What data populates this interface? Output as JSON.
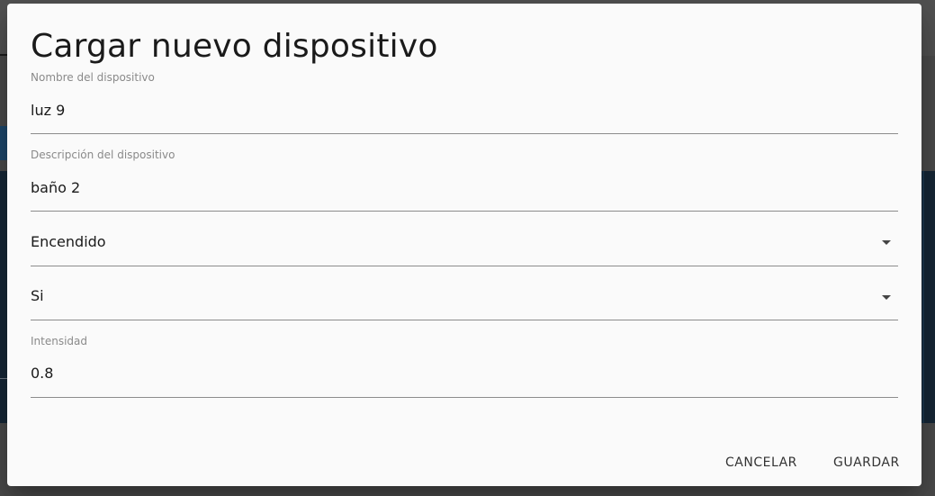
{
  "dialog": {
    "title": "Cargar nuevo dispositivo",
    "fields": {
      "name": {
        "label": "Nombre del dispositivo",
        "value": "luz 9"
      },
      "description": {
        "label": "Descripción del dispositivo",
        "value": "baño 2"
      },
      "state": {
        "value": "Encendido"
      },
      "toggle": {
        "value": "Si"
      },
      "intensity": {
        "label": "Intensidad",
        "value": "0.8"
      }
    },
    "actions": {
      "cancel_label": "CANCELAR",
      "save_label": "GUARDAR"
    }
  },
  "icons": {
    "select_caret": "arrow-drop-down-icon"
  }
}
